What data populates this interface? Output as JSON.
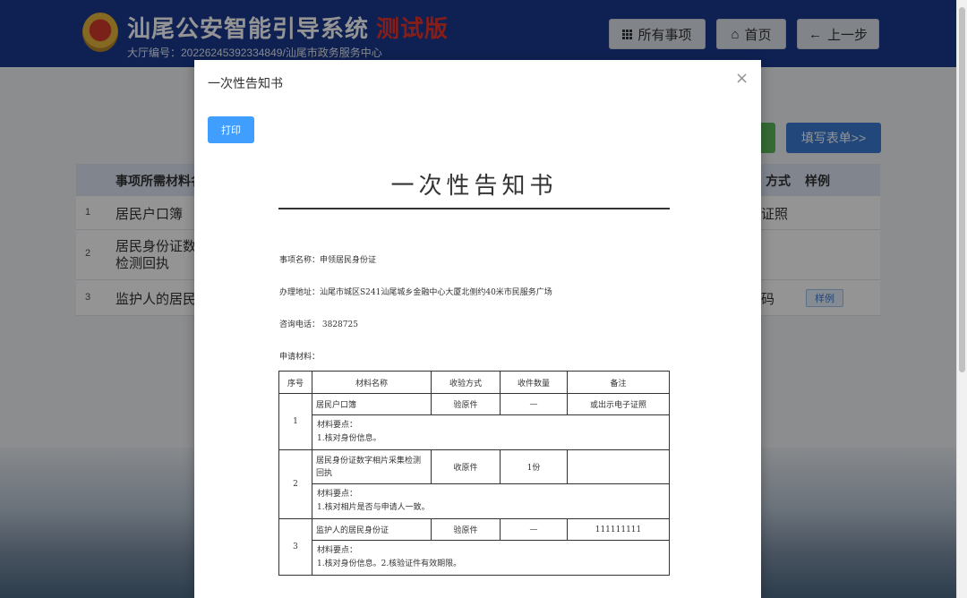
{
  "header": {
    "title": "汕尾公安智能引导系统",
    "badge": "测试版",
    "hall_info": "大厅编号：20226245392334849/汕尾市政务服务中心",
    "buttons": {
      "all_items": "所有事项",
      "home": "首页",
      "back": "上一步"
    }
  },
  "background": {
    "fill_form": "填写表单>>",
    "columns": {
      "materials": "事项所需材料名",
      "method": "方式",
      "sample": "样例"
    },
    "rows": [
      {
        "num": "1",
        "name": "居民户口簿",
        "method": "证照",
        "sample": ""
      },
      {
        "num": "2",
        "name": "居民身份证数",
        "name2": "检测回执",
        "method": "",
        "sample": ""
      },
      {
        "num": "3",
        "name": "监护人的居民",
        "method": "码",
        "sample": "样例"
      }
    ]
  },
  "modal": {
    "title": "一次性告知书",
    "close": "×",
    "print": "打印",
    "doc_title": "一次性告知书",
    "item_name": "事项名称：申领居民身份证",
    "address": "办理地址：汕尾市城区S241汕尾城乡金融中心大厦北侧约40米市民服务广场",
    "phone": "咨询电话：  3828725",
    "materials_label": "申请材料：",
    "table": {
      "headers": [
        "序号",
        "材料名称",
        "收验方式",
        "收件数量",
        "备注"
      ],
      "rows": [
        {
          "num": "1",
          "name": "居民户口簿",
          "method": "验原件",
          "qty": "—",
          "note": "或出示电子证照",
          "points_title": "材料要点：",
          "points": "1.核对身份信息。"
        },
        {
          "num": "2",
          "name": "居民身份证数字相片采集检测回执",
          "method": "收原件",
          "qty": "1份",
          "note": "",
          "points_title": "材料要点：",
          "points": "1.核对相片是否与申请人一致。"
        },
        {
          "num": "3",
          "name": "监护人的居民身份证",
          "method": "验原件",
          "qty": "—",
          "note": "111111111",
          "points_title": "材料要点：",
          "points": "1.核对身份信息。2.核验证件有效期限。"
        }
      ]
    }
  }
}
